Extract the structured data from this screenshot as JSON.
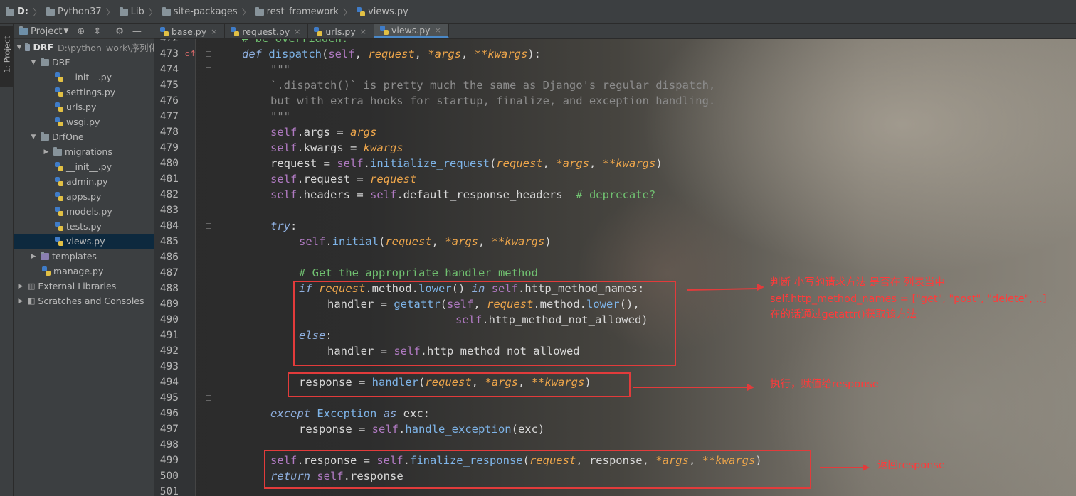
{
  "breadcrumb": [
    "D:",
    "Python37",
    "Lib",
    "site-packages",
    "rest_framework",
    "views.py"
  ],
  "tool_window_tab": "1: Project",
  "project_panel": {
    "title": "Project",
    "tree": [
      {
        "label": "DRF",
        "note": "D:\\python_work\\序列化",
        "kind": "folder-open"
      },
      {
        "label": "DRF",
        "kind": "folder-open"
      },
      {
        "label": "__init__.py",
        "kind": "py"
      },
      {
        "label": "settings.py",
        "kind": "py"
      },
      {
        "label": "urls.py",
        "kind": "py"
      },
      {
        "label": "wsgi.py",
        "kind": "py"
      },
      {
        "label": "DrfOne",
        "kind": "folder-open"
      },
      {
        "label": "migrations",
        "kind": "folder-closed"
      },
      {
        "label": "__init__.py",
        "kind": "py"
      },
      {
        "label": "admin.py",
        "kind": "py"
      },
      {
        "label": "apps.py",
        "kind": "py"
      },
      {
        "label": "models.py",
        "kind": "py"
      },
      {
        "label": "tests.py",
        "kind": "py"
      },
      {
        "label": "views.py",
        "kind": "py",
        "selected": true
      },
      {
        "label": "templates",
        "kind": "folder-closed"
      },
      {
        "label": "manage.py",
        "kind": "py"
      },
      {
        "label": "External Libraries",
        "kind": "lib"
      },
      {
        "label": "Scratches and Consoles",
        "kind": "scratch"
      }
    ]
  },
  "tabs": [
    {
      "label": "base.py"
    },
    {
      "label": "request.py"
    },
    {
      "label": "urls.py"
    },
    {
      "label": "views.py",
      "active": true
    }
  ],
  "line_numbers": [
    "473",
    "474",
    "475",
    "476",
    "477",
    "478",
    "479",
    "480",
    "481",
    "482",
    "483",
    "484",
    "485",
    "486",
    "487",
    "488",
    "489",
    "490",
    "491",
    "492",
    "493",
    "494",
    "495",
    "496",
    "497",
    "498",
    "499",
    "500",
    "501"
  ],
  "partial_top_line": {
    "number": "472",
    "text": "# be overridden."
  },
  "annotations": {
    "check_line1": "判断 小写的请求方法 是否在 列表当中",
    "check_line2": "self.http_method_names = [\"get\", \"post\", \"delete\", ..]",
    "check_line3": "在的话通过getattr()获取该方法",
    "execute": "执行，赋值给response",
    "return": "返回response"
  },
  "colors": {
    "annotation_red": "#e23b3b",
    "keyword": "#8fb0e0",
    "self": "#b07ac2",
    "param": "#eea64b",
    "comment": "#70c070"
  }
}
